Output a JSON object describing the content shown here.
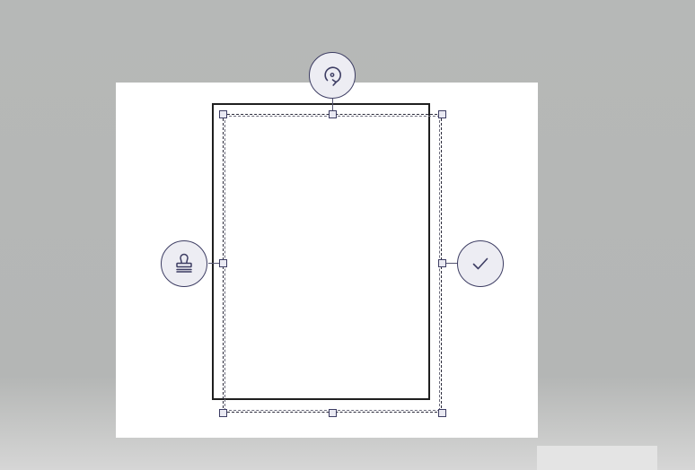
{
  "editor": {
    "tools": {
      "rotate": {
        "icon": "rotate-icon"
      },
      "stamp": {
        "icon": "stamp-icon"
      },
      "confirm": {
        "icon": "checkmark-icon"
      }
    },
    "colors": {
      "background": "#b6b8b7",
      "canvas": "#ffffff",
      "accent": "#3d3d63",
      "button_fill": "#ededf3"
    }
  }
}
